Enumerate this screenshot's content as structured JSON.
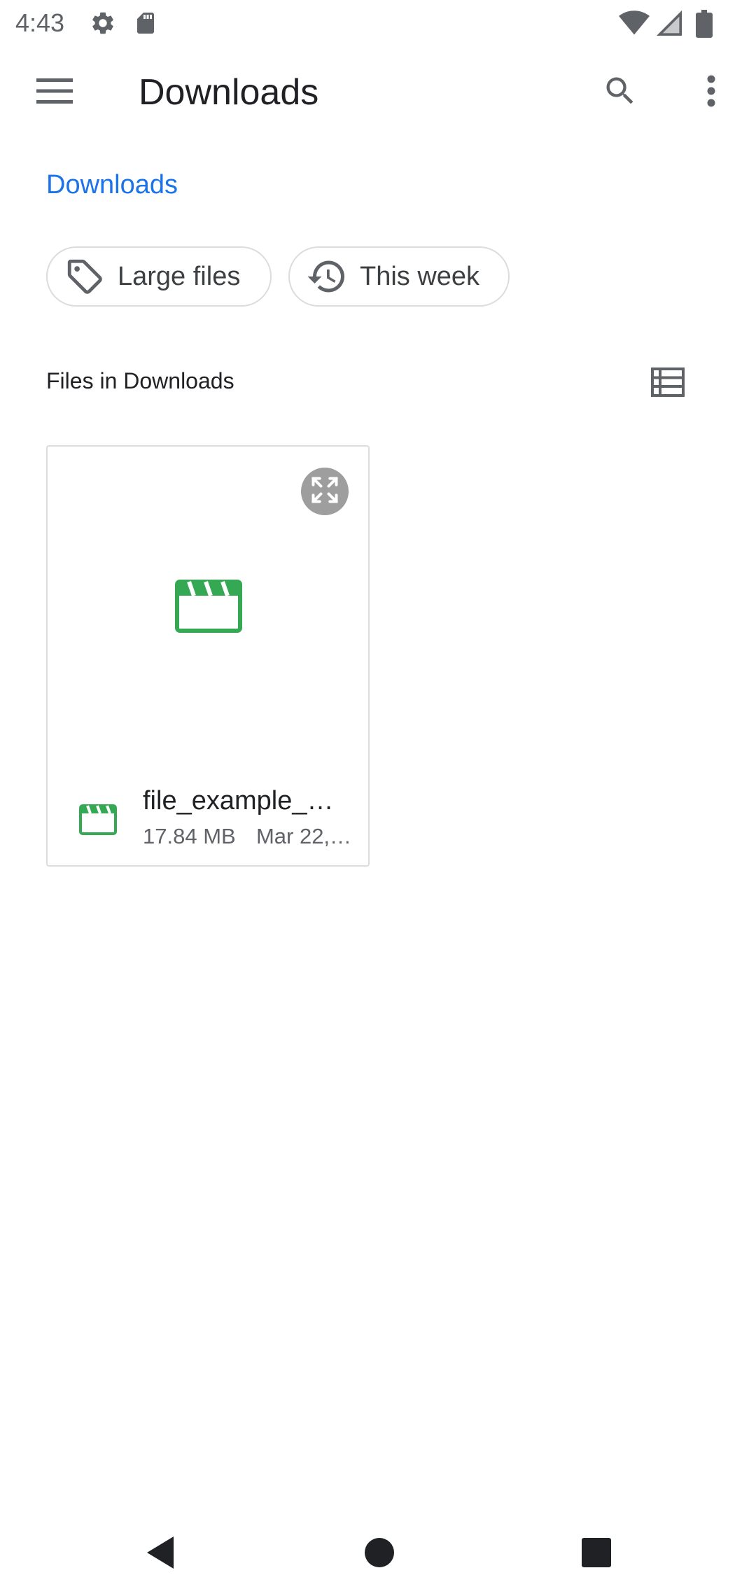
{
  "status_bar": {
    "time": "4:43",
    "icons": [
      "settings-icon",
      "sd-card-icon",
      "wifi-icon",
      "signal-icon",
      "battery-icon"
    ]
  },
  "app_bar": {
    "title": "Downloads",
    "icons": [
      "menu-icon",
      "search-icon",
      "more-vert-icon"
    ]
  },
  "breadcrumb": {
    "label": "Downloads"
  },
  "chips": [
    {
      "label": "Large files",
      "icon": "label-tag-icon"
    },
    {
      "label": "This week",
      "icon": "history-icon"
    }
  ],
  "section": {
    "title": "Files in Downloads",
    "view_toggle_icon": "list-view-icon"
  },
  "files": [
    {
      "name": "file_example_…",
      "size": "17.84 MB",
      "date": "Mar 22,…",
      "type_icon": "video-clapper-icon"
    }
  ],
  "nav_bar": {
    "icons": [
      "back-icon",
      "home-icon",
      "recents-icon"
    ]
  },
  "colors": {
    "accent": "#1a73e8",
    "video_green": "#34a853",
    "border": "#dadce0",
    "text_primary": "#202124",
    "text_secondary": "#5f6368",
    "status_icons": "#5f6368"
  }
}
